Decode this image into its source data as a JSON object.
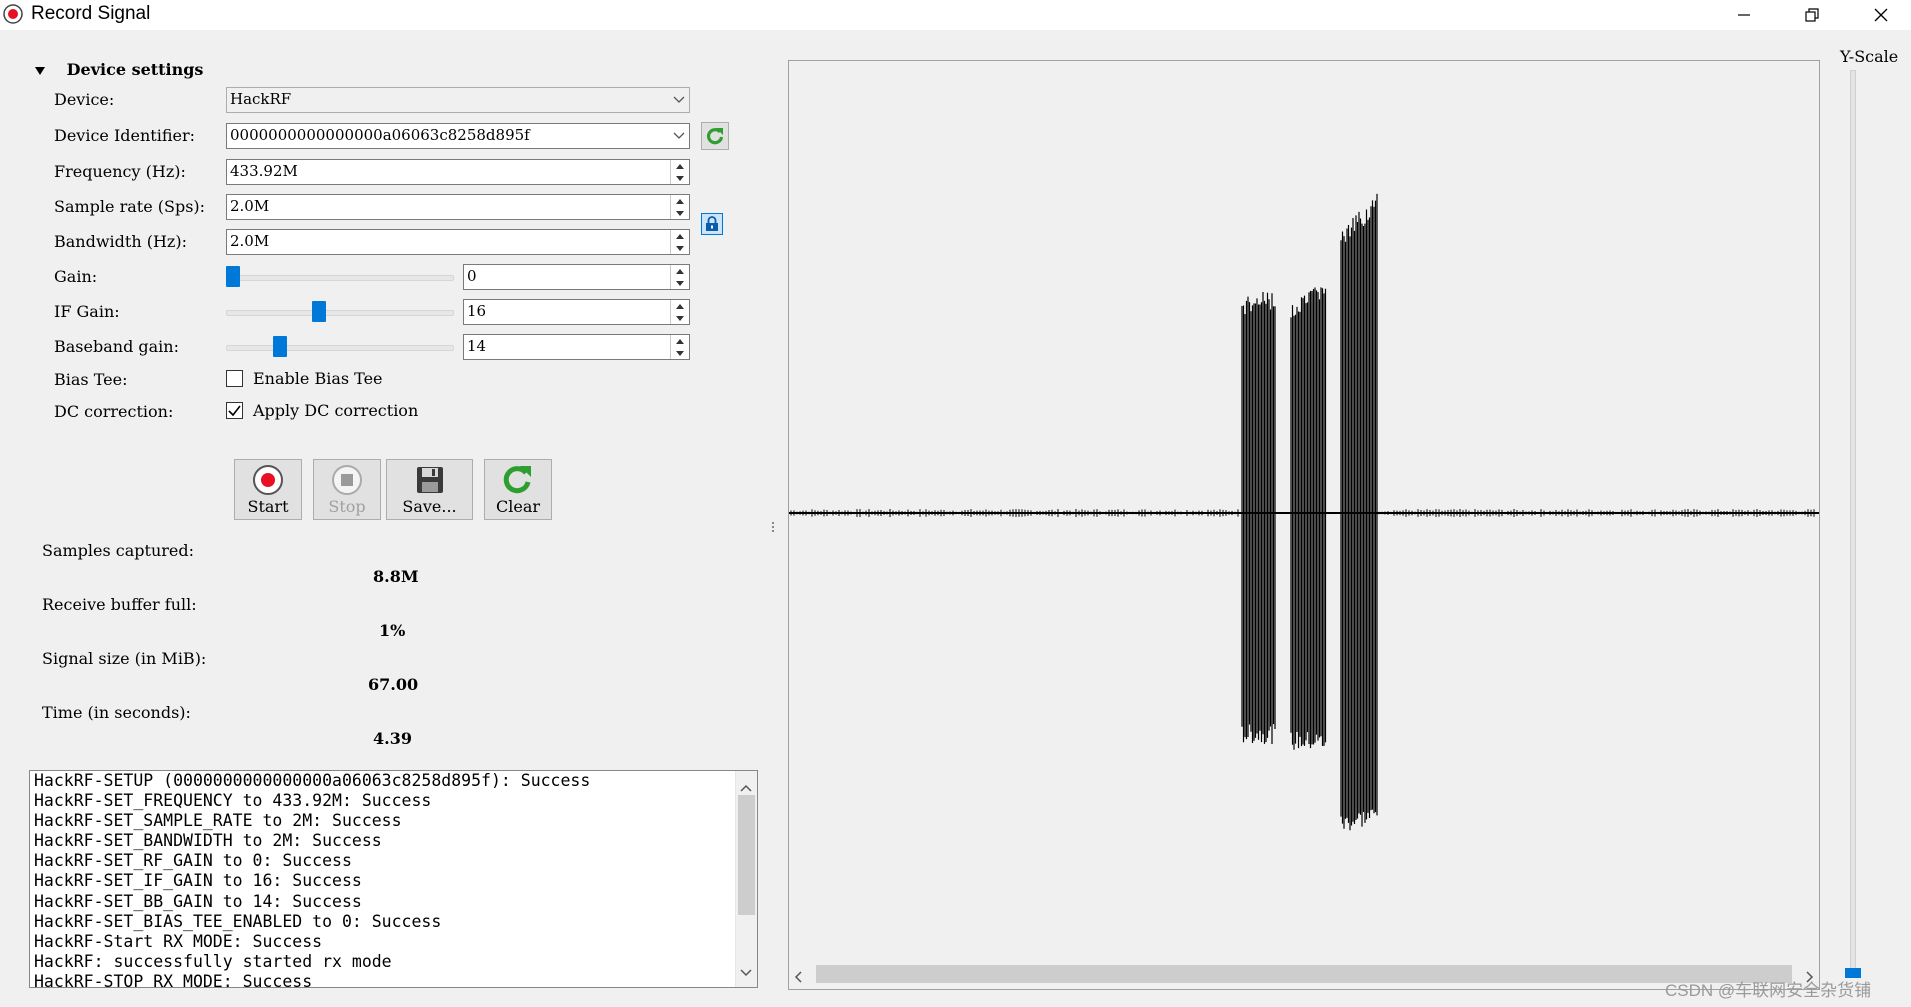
{
  "window": {
    "title": "Record Signal"
  },
  "device_settings": {
    "header": "Device settings",
    "device_label": "Device:",
    "device_value": "HackRF",
    "identifier_label": "Device Identifier:",
    "identifier_value": "0000000000000000a06063c8258d895f",
    "frequency_label": "Frequency (Hz):",
    "frequency_value": "433.92M",
    "sample_rate_label": "Sample rate (Sps):",
    "sample_rate_value": "2.0M",
    "bandwidth_label": "Bandwidth (Hz):",
    "bandwidth_value": "2.0M",
    "gain_label": "Gain:",
    "gain_value": "0",
    "gain_level": 0.0,
    "if_gain_label": "IF Gain:",
    "if_gain_value": "16",
    "if_gain_level": 0.4,
    "bb_gain_label": "Baseband gain:",
    "bb_gain_value": "14",
    "bb_gain_level": 0.22,
    "bias_tee_label": "Bias Tee:",
    "bias_tee_checkbox": "Enable Bias Tee",
    "bias_tee_checked": false,
    "dc_label": "DC correction:",
    "dc_checkbox": "Apply DC correction",
    "dc_checked": true
  },
  "toolbar": {
    "start": "Start",
    "stop": "Stop",
    "save": "Save...",
    "clear": "Clear"
  },
  "stats": {
    "samples_label": "Samples captured:",
    "samples_value": "8.8M",
    "buffer_label": "Receive buffer full:",
    "buffer_value": "1%",
    "size_label": "Signal size (in MiB):",
    "size_value": "67.00",
    "time_label": "Time (in seconds):",
    "time_value": "4.39"
  },
  "log": [
    "HackRF-SETUP (0000000000000000a06063c8258d895f): Success",
    "HackRF-SET_FREQUENCY to 433.92M: Success",
    "HackRF-SET_SAMPLE_RATE to 2M: Success",
    "HackRF-SET_BANDWIDTH to 2M: Success",
    "HackRF-SET_RF_GAIN to 0: Success",
    "HackRF-SET_IF_GAIN to 16: Success",
    "HackRF-SET_BB_GAIN to 14: Success",
    "HackRF-SET_BIAS_TEE_ENABLED to 0: Success",
    "HackRF-Start RX MODE: Success",
    "HackRF: successfully started rx mode",
    "HackRF-STOP_RX_MODE: Success"
  ],
  "plot": {
    "yscale_label": "Y-Scale"
  },
  "watermark": "CSDN @车联网安全杂货铺",
  "colors": {
    "accent": "#0078d7",
    "record": "#e81123",
    "clear": "#2e9e2e"
  }
}
